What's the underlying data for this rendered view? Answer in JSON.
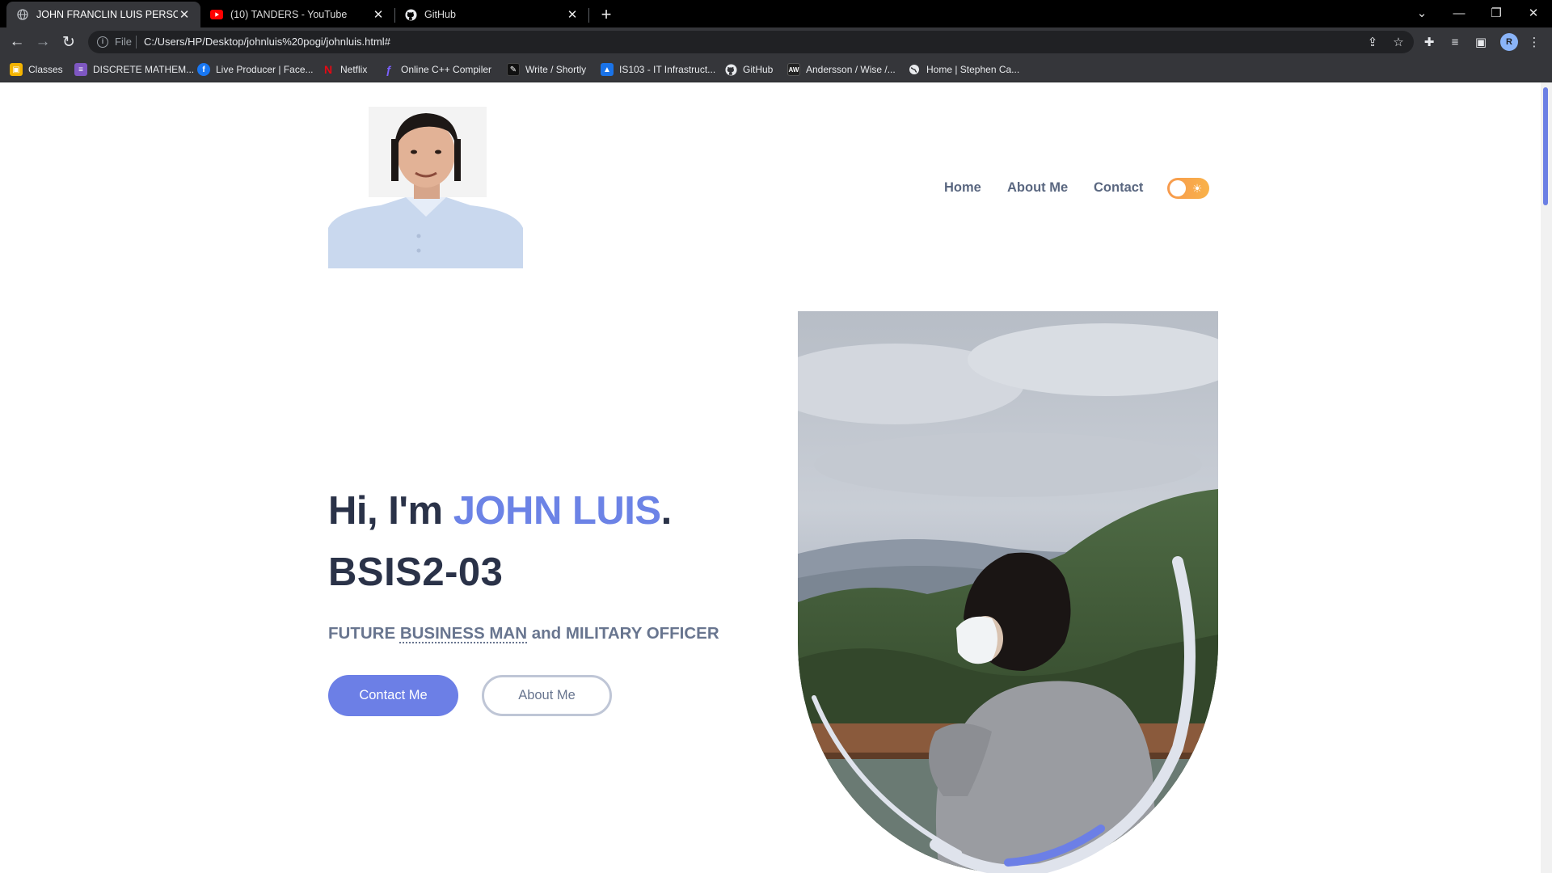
{
  "browser": {
    "tabs": [
      {
        "title": "JOHN FRANCLIN LUIS PERSONAL",
        "icon": "globe-icon",
        "active": true
      },
      {
        "title": "(10) TANDERS - YouTube",
        "icon": "youtube-icon",
        "active": false
      },
      {
        "title": "GitHub",
        "icon": "github-icon",
        "active": false
      }
    ],
    "address": {
      "scheme_label": "File",
      "url": "C:/Users/HP/Desktop/johnluis%20pogi/johnluis.html#"
    },
    "profile_initial": "R",
    "bookmarks": [
      {
        "label": "Classes",
        "icon": "google-classroom-icon",
        "color": "#f4b400"
      },
      {
        "label": "DISCRETE MATHEM...",
        "icon": "book-icon",
        "color": "#7e57c2"
      },
      {
        "label": "Live Producer | Face...",
        "icon": "facebook-icon",
        "color": "#1877f2"
      },
      {
        "label": "Netflix",
        "icon": "netflix-icon",
        "color": "#e50914"
      },
      {
        "label": "Online C++ Compiler",
        "icon": "compiler-icon",
        "color": "#7b61ff"
      },
      {
        "label": "Write / Shortly",
        "icon": "pen-icon",
        "color": "#111111"
      },
      {
        "label": "IS103 - IT Infrastruct...",
        "icon": "classroom-icon",
        "color": "#1a73e8"
      },
      {
        "label": "GitHub",
        "icon": "github-icon",
        "color": "#000000"
      },
      {
        "label": "Andersson / Wise /...",
        "icon": "wise-icon",
        "color": "#222222"
      },
      {
        "label": "Home | Stephen Ca...",
        "icon": "globe-icon",
        "color": "#555555"
      }
    ]
  },
  "site": {
    "nav": {
      "home": "Home",
      "about": "About Me",
      "contact": "Contact"
    },
    "theme_toggle": {
      "state": "light",
      "icon": "sun-icon"
    },
    "hero": {
      "greeting": "Hi, I'm ",
      "name": "JOHN LUIS",
      "period": ".",
      "section": "BSIS2-03",
      "subtitle_pre": "FUTURE ",
      "subtitle_emph": "BUSINESS MAN",
      "subtitle_post": " and MILITARY OFFICER",
      "contact_button": "Contact Me",
      "about_button": "About Me"
    },
    "colors": {
      "accent": "#6c83e6",
      "heading": "#2a3248",
      "muted": "#68758f",
      "toggle": "#f79a4d"
    }
  }
}
